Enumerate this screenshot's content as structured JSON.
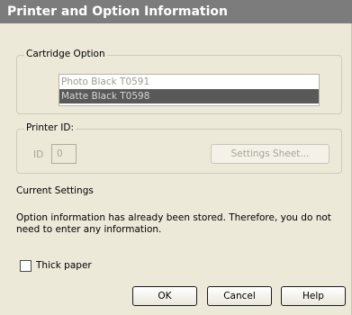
{
  "window": {
    "title": "Printer and Option Information"
  },
  "cartridge": {
    "label": "Cartridge Option",
    "options": [
      "Photo Black T0591",
      "Matte Black T0598"
    ],
    "selected": "Matte Black T0598"
  },
  "printer_id": {
    "label": "Printer ID:",
    "id_label": "ID",
    "id_value": "0",
    "settings_button": "Settings Sheet..."
  },
  "current_settings": {
    "heading": "Current Settings",
    "message": "Option information has already been stored. Therefore, you do not need to enter any information."
  },
  "thick_paper": {
    "label": "Thick paper",
    "checked": false
  },
  "buttons": {
    "ok": "OK",
    "cancel": "Cancel",
    "help": "Help"
  }
}
